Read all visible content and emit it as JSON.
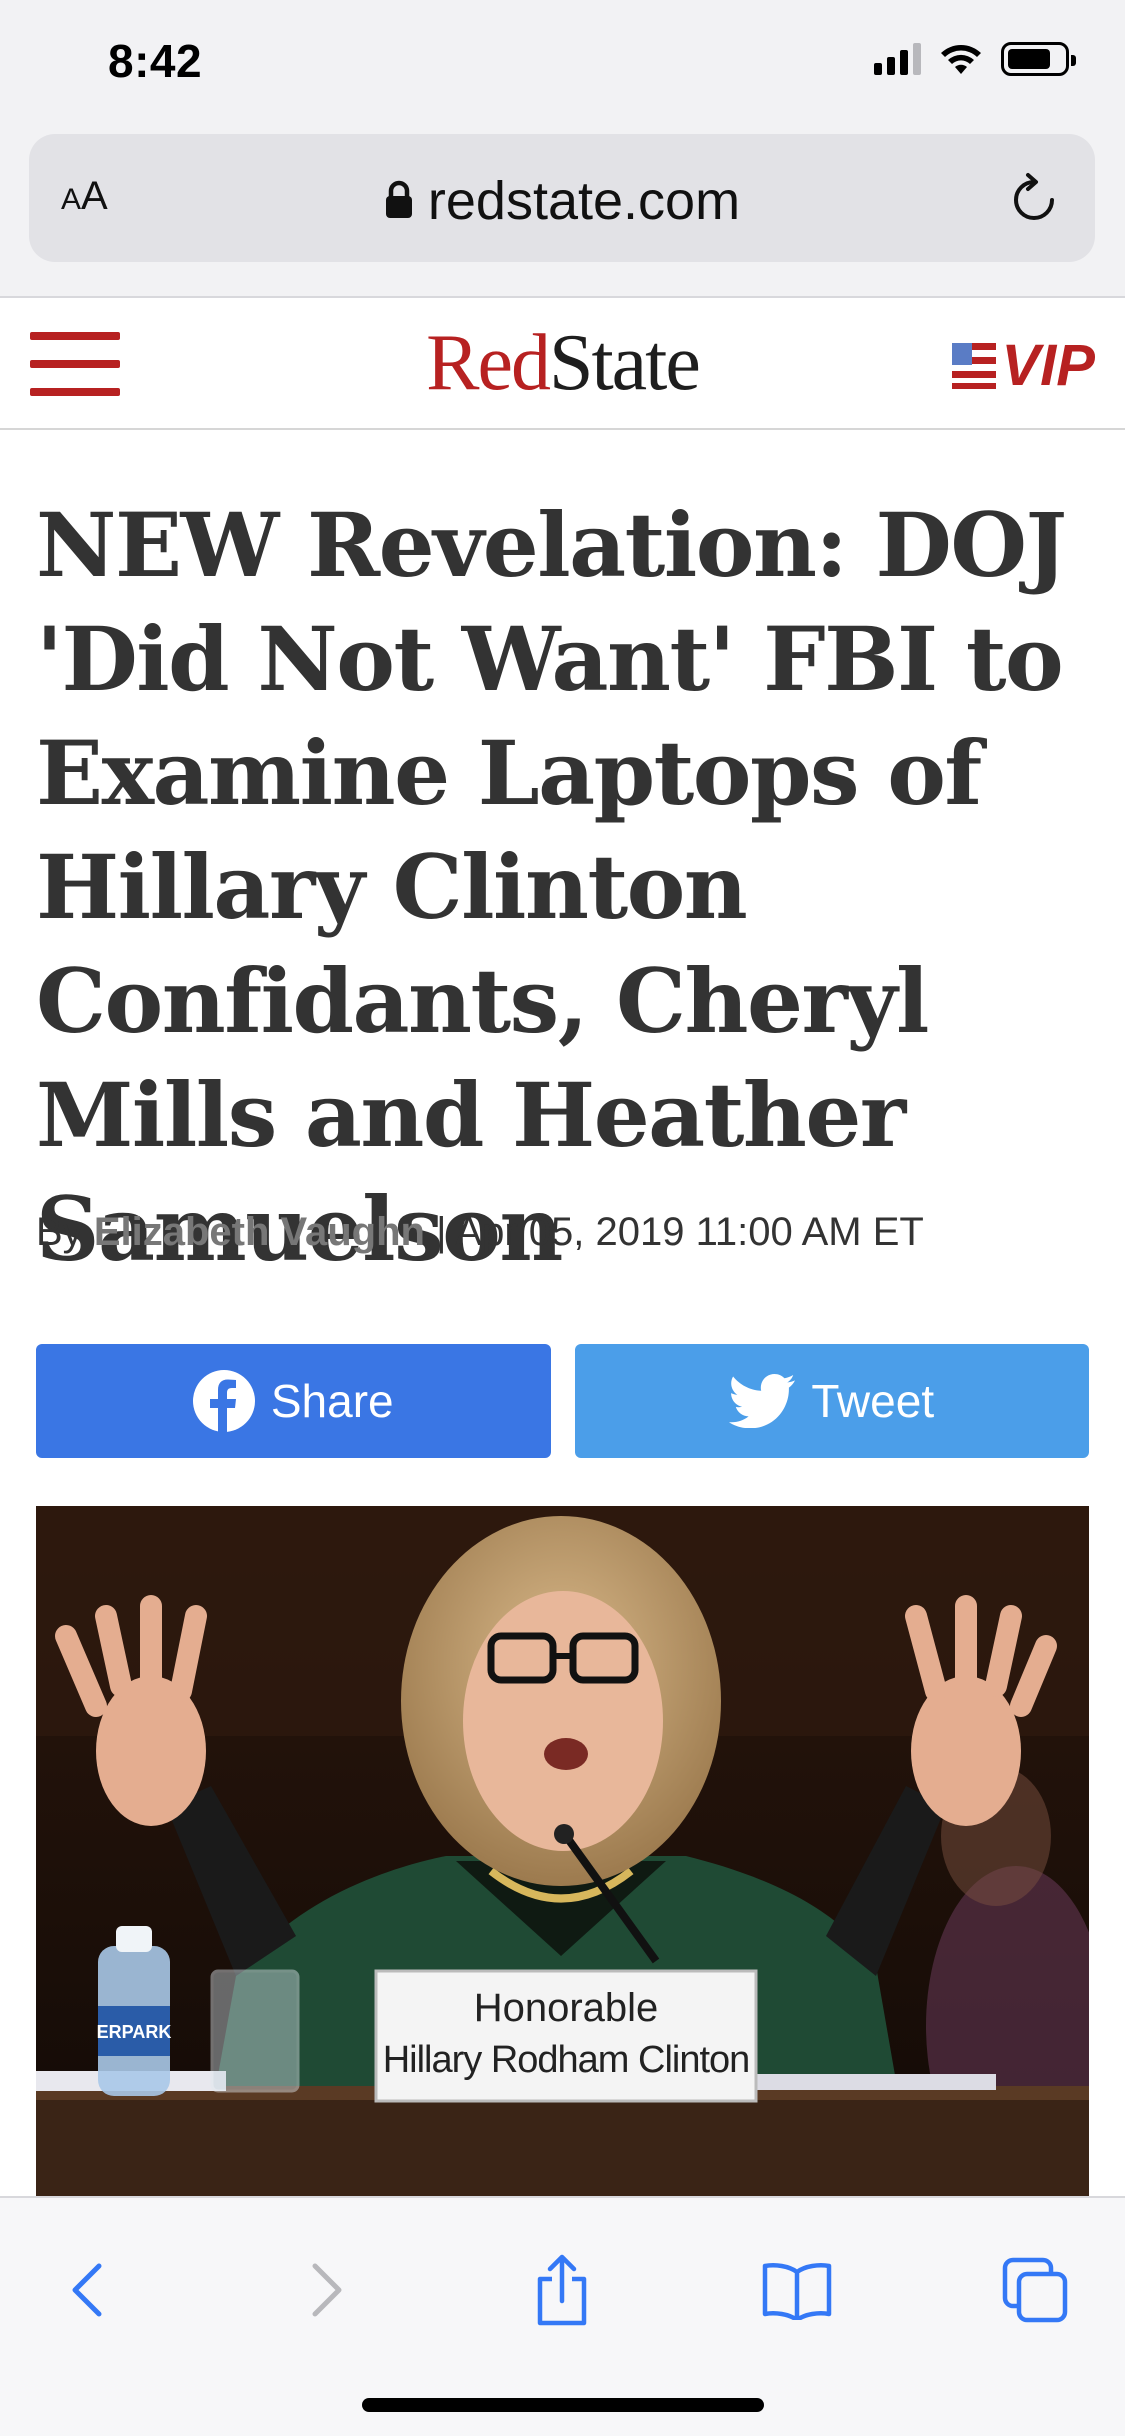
{
  "status_bar": {
    "time": "8:42"
  },
  "browser": {
    "text_size_label_small": "A",
    "text_size_label_large": "A",
    "url": "redstate.com"
  },
  "site": {
    "logo_red": "Red",
    "logo_black": "State",
    "vip_label": "VIP"
  },
  "article": {
    "headline": "NEW Revelation: DOJ 'Did Not Want' FBI to Examine Laptops of Hillary Clinton Confidants, Cheryl Mills and Heather Samuelson",
    "byline_prefix": "By",
    "author": "Elizabeth Vaughn",
    "separator": "|",
    "date": "Apr 05, 2019 11:00 AM ET",
    "share_label": "Share",
    "tweet_label": "Tweet",
    "photo": {
      "placard_line1": "Honorable",
      "placard_line2": "Hillary Rodham Clinton",
      "bottle_label": "ERPARK"
    }
  },
  "colors": {
    "brand_red": "#b72121",
    "facebook_blue": "#3a76e4",
    "twitter_blue": "#4b9ee9",
    "ios_blue": "#3478f6"
  },
  "icons": [
    "lock-icon",
    "reload-icon",
    "facebook-icon",
    "twitter-icon",
    "back-icon",
    "forward-icon",
    "share-icon",
    "bookmarks-icon",
    "tabs-icon"
  ]
}
